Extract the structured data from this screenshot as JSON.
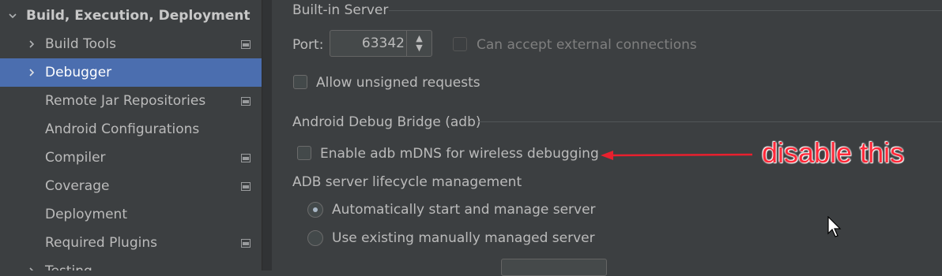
{
  "sidebar": {
    "header": "Build, Execution, Deployment",
    "items": [
      {
        "label": "Build Tools"
      },
      {
        "label": "Debugger"
      },
      {
        "label": "Remote Jar Repositories"
      },
      {
        "label": "Android Configurations"
      },
      {
        "label": "Compiler"
      },
      {
        "label": "Coverage"
      },
      {
        "label": "Deployment"
      },
      {
        "label": "Required Plugins"
      },
      {
        "label": "Testing"
      }
    ]
  },
  "builtin_server": {
    "title": "Built-in Server",
    "port_label": "Port:",
    "port_value": "63342",
    "external_connections_label": "Can accept external connections",
    "unsigned_requests_label": "Allow unsigned requests"
  },
  "adb": {
    "title": "Android Debug Bridge (adb)",
    "mdns_label": "Enable adb mDNS for wireless debugging",
    "lifecycle_label": "ADB server lifecycle management",
    "auto_start_label": "Automatically start and manage server",
    "existing_server_label": "Use existing manually managed server"
  },
  "annotation": {
    "text": "disable this",
    "color": "#ff2a3a"
  },
  "colors": {
    "selected_row": "#4b6eaf",
    "background": "#3c3f41"
  }
}
